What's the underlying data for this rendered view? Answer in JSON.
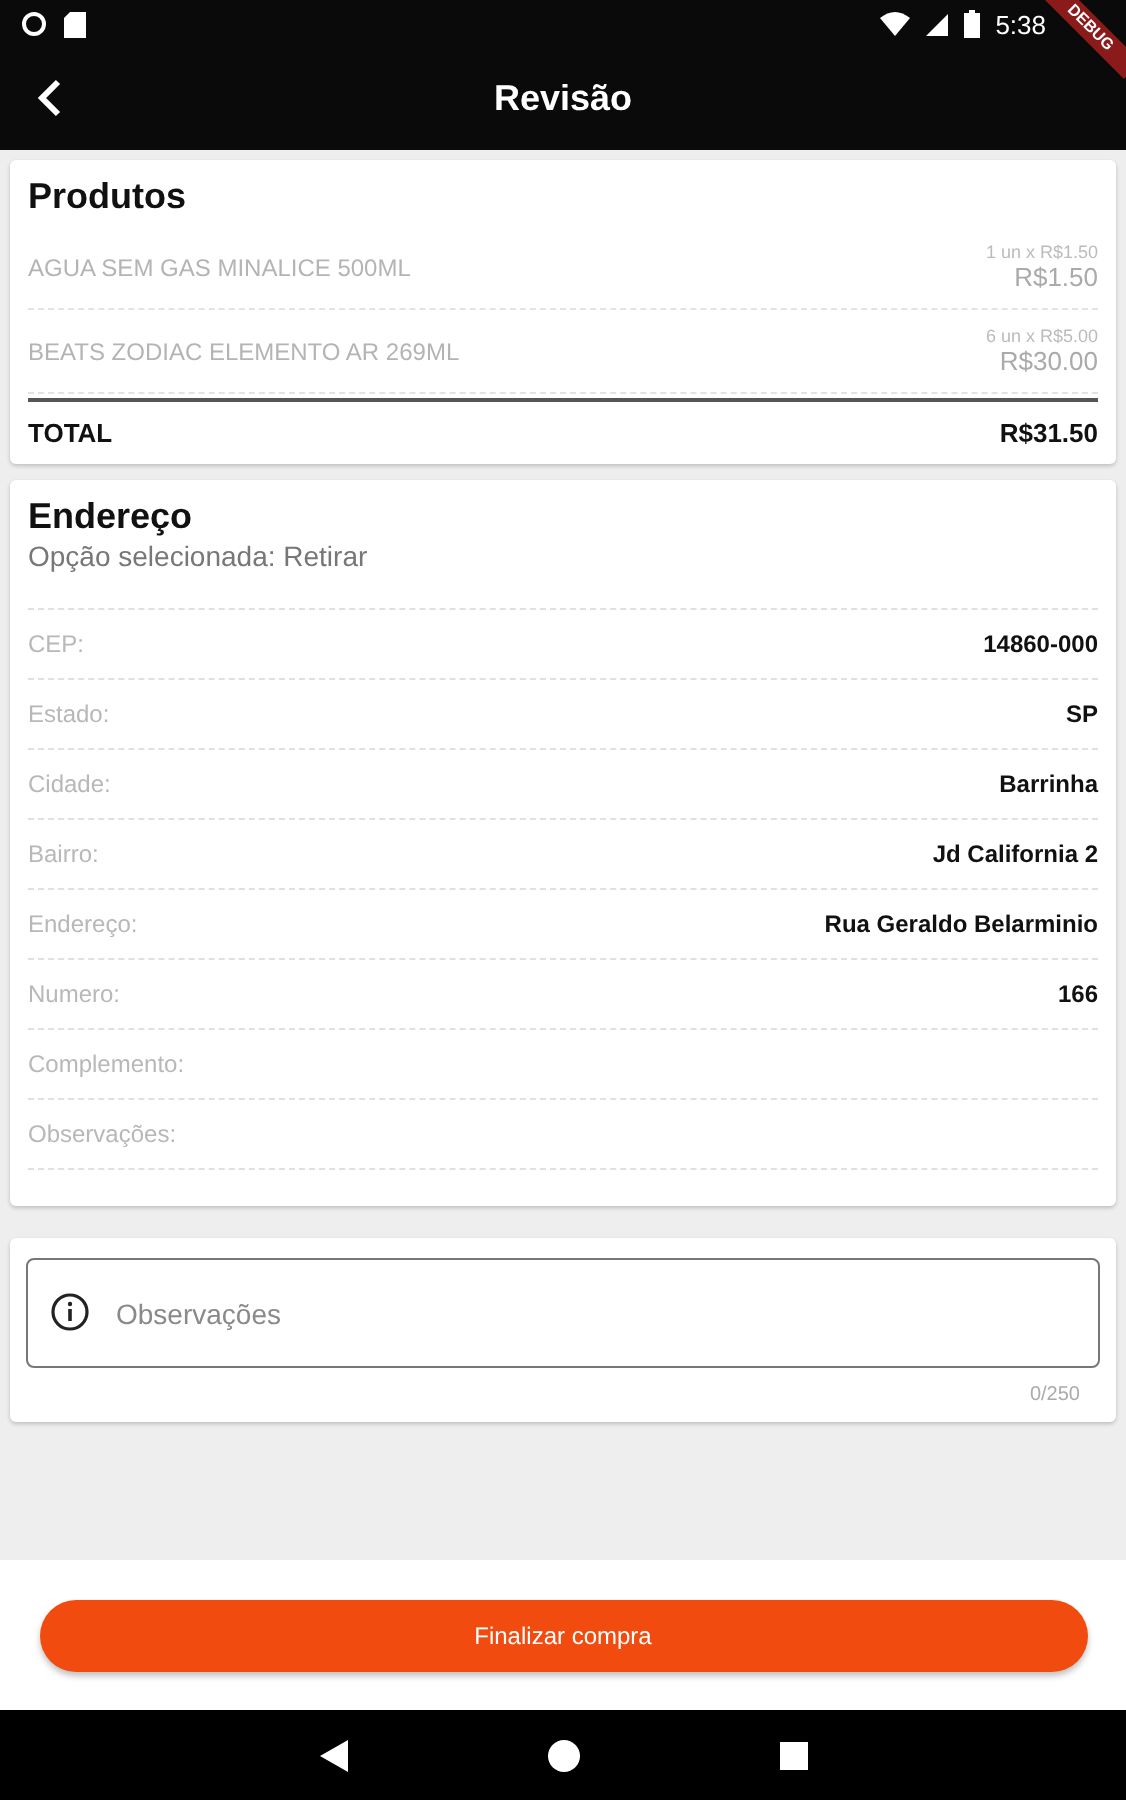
{
  "status_bar": {
    "time": "5:38",
    "debug_banner": "DEBUG"
  },
  "app_bar": {
    "title": "Revisão"
  },
  "products": {
    "title": "Produtos",
    "items": [
      {
        "name": "AGUA SEM GAS MINALICE 500ML",
        "unit": "1 un x R$1.50",
        "price": "R$1.50"
      },
      {
        "name": "BEATS ZODIAC ELEMENTO AR 269ML",
        "unit": "6 un x R$5.00",
        "price": "R$30.00"
      }
    ],
    "total_label": "TOTAL",
    "total": "R$31.50"
  },
  "address": {
    "title": "Endereço",
    "subtitle": "Opção selecionada: Retirar",
    "fields": [
      {
        "label": "CEP:",
        "value": "14860-000"
      },
      {
        "label": "Estado:",
        "value": "SP"
      },
      {
        "label": "Cidade:",
        "value": "Barrinha"
      },
      {
        "label": "Bairro:",
        "value": "Jd California 2"
      },
      {
        "label": "Endereço:",
        "value": "Rua Geraldo Belarminio"
      },
      {
        "label": "Numero:",
        "value": "166"
      },
      {
        "label": "Complemento:"
      },
      {
        "label": "Observações:"
      }
    ]
  },
  "notes": {
    "placeholder": "Observações",
    "counter": "0/250"
  },
  "button": "Finalizar compra"
}
